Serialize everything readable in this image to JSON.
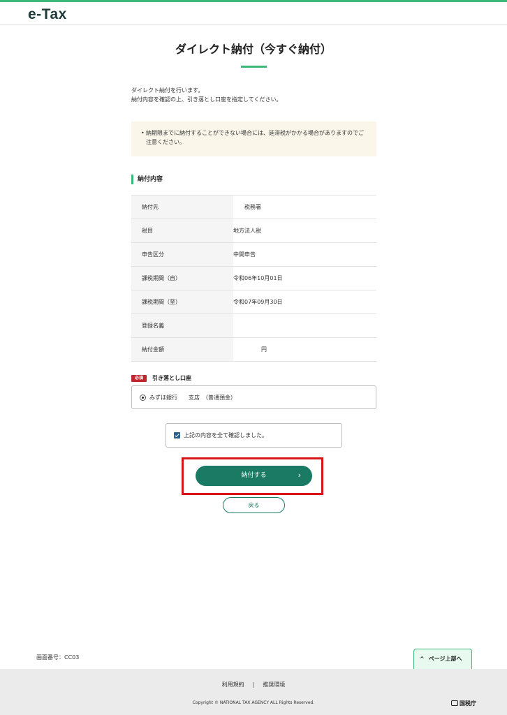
{
  "header": {
    "logo": "e-Tax"
  },
  "page": {
    "title": "ダイレクト納付（今すぐ納付）",
    "intro_line1": "ダイレクト納付を行います。",
    "intro_line2": "納付内容を確認の上、引き落とし口座を指定してください。"
  },
  "notice": {
    "bullet": "•",
    "text": "納期限までに納付することができない場合には、延滞税がかかる場合がありますのでご注意ください。"
  },
  "payment_details": {
    "heading": "納付内容",
    "rows": [
      {
        "label": "納付先",
        "value": "　　税務署"
      },
      {
        "label": "税目",
        "value": "地方法人税"
      },
      {
        "label": "申告区分",
        "value": "中間申告"
      },
      {
        "label": "課税期間（自）",
        "value": "令和06年10月01日"
      },
      {
        "label": "課税期間（至）",
        "value": "令和07年09月30日"
      },
      {
        "label": "登録名義",
        "value": ""
      },
      {
        "label": "納付金額",
        "value": "　　　　　円"
      }
    ]
  },
  "account": {
    "required_badge": "必須",
    "label": "引き落とし口座",
    "option": "みずほ銀行　　支店　（普通預金）"
  },
  "confirm": {
    "label": "上記の内容を全て確認しました。"
  },
  "buttons": {
    "pay": "納付する",
    "pay_chevron": "›",
    "back": "戻る"
  },
  "screen_id": "画面番号：CC03",
  "to_top": {
    "caret": "^",
    "label": "ページ上部へ"
  },
  "footer": {
    "terms": "利用規約",
    "separator": "|",
    "environment": "推奨環境",
    "copyright": "Copyright © NATIONAL TAX AGENCY ALL Rights Reserved.",
    "agency": "国税庁"
  },
  "colors": {
    "accent": "#3cb878",
    "primary_button": "#1a7a64",
    "highlight": "#d7141a",
    "required": "#c0262d"
  }
}
